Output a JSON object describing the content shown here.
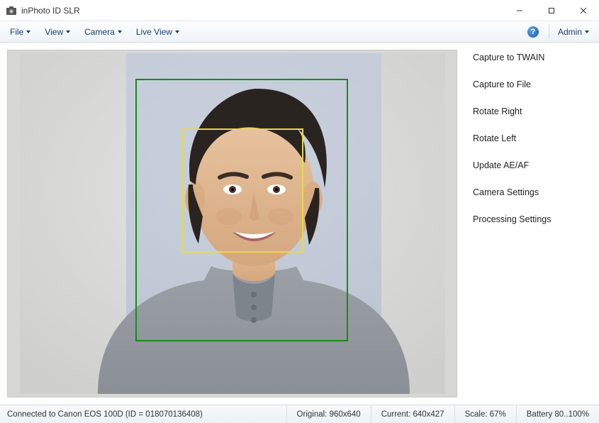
{
  "window": {
    "title": "inPhoto ID SLR"
  },
  "menu": {
    "file": "File",
    "view": "View",
    "camera": "Camera",
    "liveview": "Live View",
    "help_glyph": "?",
    "admin": "Admin"
  },
  "actions": {
    "capture_twain": "Capture to TWAIN",
    "capture_file": "Capture to File",
    "rotate_right": "Rotate Right",
    "rotate_left": "Rotate Left",
    "update_aeaf": "Update AE/AF",
    "camera_settings": "Camera Settings",
    "processing_settings": "Processing Settings"
  },
  "status": {
    "connection": "Connected to Canon EOS 100D (ID = 018070136408)",
    "original": "Original: 960x640",
    "current": "Current: 640x427",
    "scale": "Scale: 67%",
    "battery": "Battery 80..100%"
  }
}
